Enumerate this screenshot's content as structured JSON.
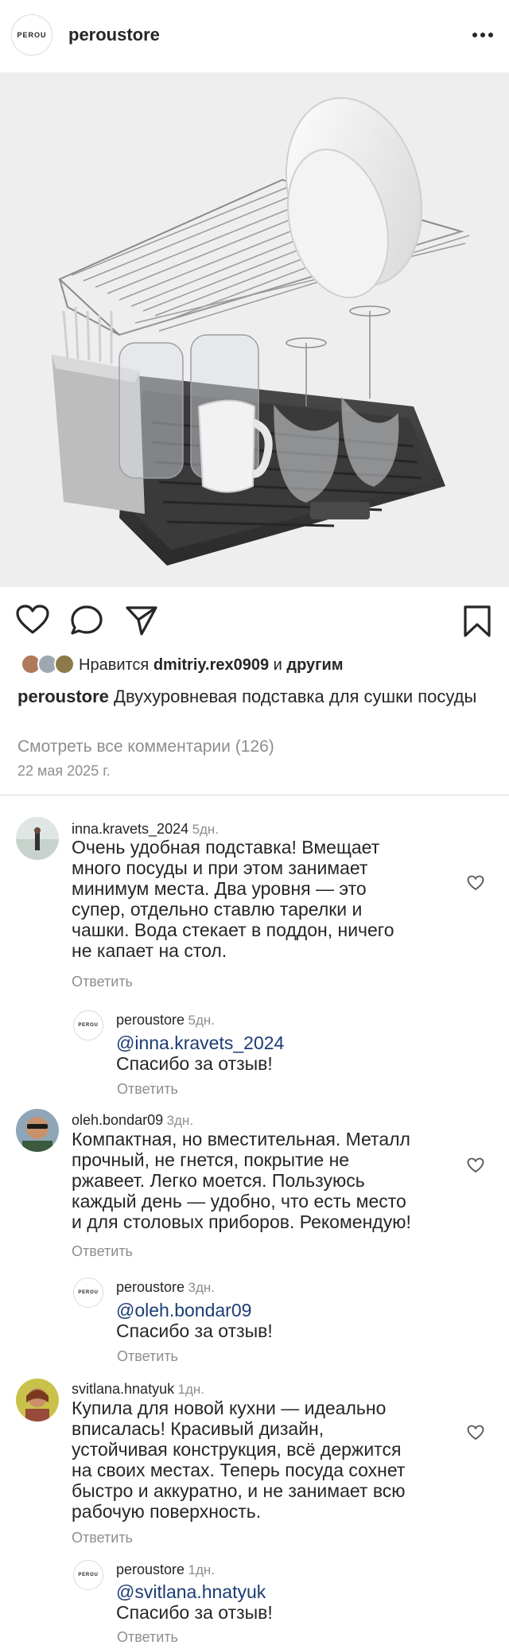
{
  "header": {
    "avatar_text": "PEROU",
    "username": "peroustore",
    "more_icon": "more-horizontal-icon"
  },
  "post": {
    "image_alt": "dish-drying-rack-photo",
    "actions": {
      "like_icon": "heart-icon",
      "comment_icon": "comment-icon",
      "share_icon": "send-icon",
      "save_icon": "bookmark-icon"
    },
    "likes": {
      "prefix": "Нравится",
      "user": "dmitriy.rex0909",
      "conj": "и",
      "others": "другим"
    },
    "caption": {
      "username": "peroustore",
      "text": "Двухуровневая подставка для сушки посуды"
    },
    "view_comments": "Смотреть все комментарии (126)",
    "date": "22 мая 2025 г."
  },
  "comments": [
    {
      "username": "inna.kravets_2024",
      "time": "5дн.",
      "lines": [
        "Очень удобная подставка! Вмещает",
        "много посуды и при этом занимает",
        "минимум места. Два уровня — это",
        "супер, отдельно ставлю тарелки и",
        "чашки. Вода стекает в поддон, ничего",
        "не капает на стол."
      ],
      "reply_label": "Ответить",
      "reply": {
        "avatar_text": "PEROU",
        "username": "peroustore",
        "time": "5дн.",
        "mention": "@inna.kravets_2024",
        "text": "Спасибо за отзыв!",
        "reply_label": "Ответить"
      }
    },
    {
      "username": "oleh.bondar09",
      "time": "3дн.",
      "lines": [
        "Компактная, но вместительная. Металл",
        "прочный, не гнется, покрытие не",
        "ржавеет. Легко моется. Пользуюсь",
        "каждый день — удобно, что есть место",
        "и для столовых приборов. Рекомендую!"
      ],
      "reply_label": "Ответить",
      "reply": {
        "avatar_text": "PEROU",
        "username": "peroustore",
        "time": "3дн.",
        "mention": "@oleh.bondar09",
        "text": "Спасибо за отзыв!",
        "reply_label": "Ответить"
      }
    },
    {
      "username": "svitlana.hnatyuk",
      "time": "1дн.",
      "lines": [
        "Купила для новой кухни — идеально",
        "вписалась! Красивый дизайн,",
        "устойчивая конструкция, всё держится",
        "на своих местах. Теперь посуда сохнет",
        "быстро и аккуратно, и не занимает всю",
        "рабочую поверхность."
      ],
      "reply_label": "Ответить",
      "reply": {
        "avatar_text": "PEROU",
        "username": "peroustore",
        "time": "1дн.",
        "mention": "@svitlana.hnatyuk",
        "text": "Спасибо за отзыв!",
        "reply_label": "Ответить"
      }
    }
  ]
}
